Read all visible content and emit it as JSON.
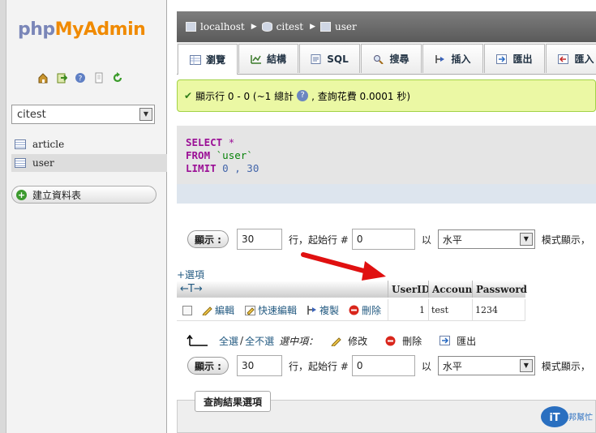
{
  "sidebar": {
    "logo": {
      "php": "php",
      "my": "My",
      "admin": "Admin"
    },
    "icons": [
      "home-icon",
      "exit-icon",
      "help-icon",
      "docs-icon",
      "reload-icon"
    ],
    "database_selected": "citest",
    "tables": [
      {
        "name": "article"
      },
      {
        "name": "user"
      }
    ],
    "create_table_label": "建立資料表"
  },
  "breadcrumb": {
    "server": "localhost",
    "database": "citest",
    "table": "user"
  },
  "tabs": [
    {
      "label": "瀏覽",
      "icon": "browse-icon"
    },
    {
      "label": "結構",
      "icon": "structure-icon"
    },
    {
      "label": "SQL",
      "icon": "sql-icon"
    },
    {
      "label": "搜尋",
      "icon": "search-icon"
    },
    {
      "label": "插入",
      "icon": "insert-icon"
    },
    {
      "label": "匯出",
      "icon": "export-icon"
    },
    {
      "label": "匯入",
      "icon": "import-icon"
    }
  ],
  "notice": {
    "text_before": "顯示行 0 - 0 (~1 總計",
    "text_after": ", 查詢花費 0.0001 秒)"
  },
  "sql": {
    "select": "SELECT",
    "star": "*",
    "from": "FROM",
    "table": "`user`",
    "limit": "LIMIT",
    "offset": "0",
    "comma": ",",
    "count": "30"
  },
  "nav": {
    "show_label": "顯示 :",
    "rows_value": "30",
    "start_label": "行，起始行 #",
    "start_value": "0",
    "mode_label": "以",
    "mode_value": "水平",
    "mode_suffix": "模式顯示，"
  },
  "table": {
    "options_link": "+選項",
    "arrows": "←T→",
    "columns": [
      "UserID",
      "Account",
      "Password"
    ],
    "row_actions": [
      "編輯",
      "快速編輯",
      "複製",
      "刪除"
    ],
    "rows": [
      {
        "UserID": "1",
        "Account": "test",
        "Password": "1234"
      }
    ]
  },
  "batch": {
    "check_all": "全選",
    "sep": "/",
    "uncheck_all": "全不選",
    "selected_label": "選中項：",
    "actions": [
      "修改",
      "刪除",
      "匯出"
    ]
  },
  "results_options_label": "查詢結果選項",
  "watermark": {
    "text1": "iT",
    "text2": "邦幫忙"
  },
  "colors": {
    "notice_bg": "#ebf8a4",
    "keyword": "#9b0f96",
    "string": "#08820a",
    "arrow": "#e01010"
  }
}
